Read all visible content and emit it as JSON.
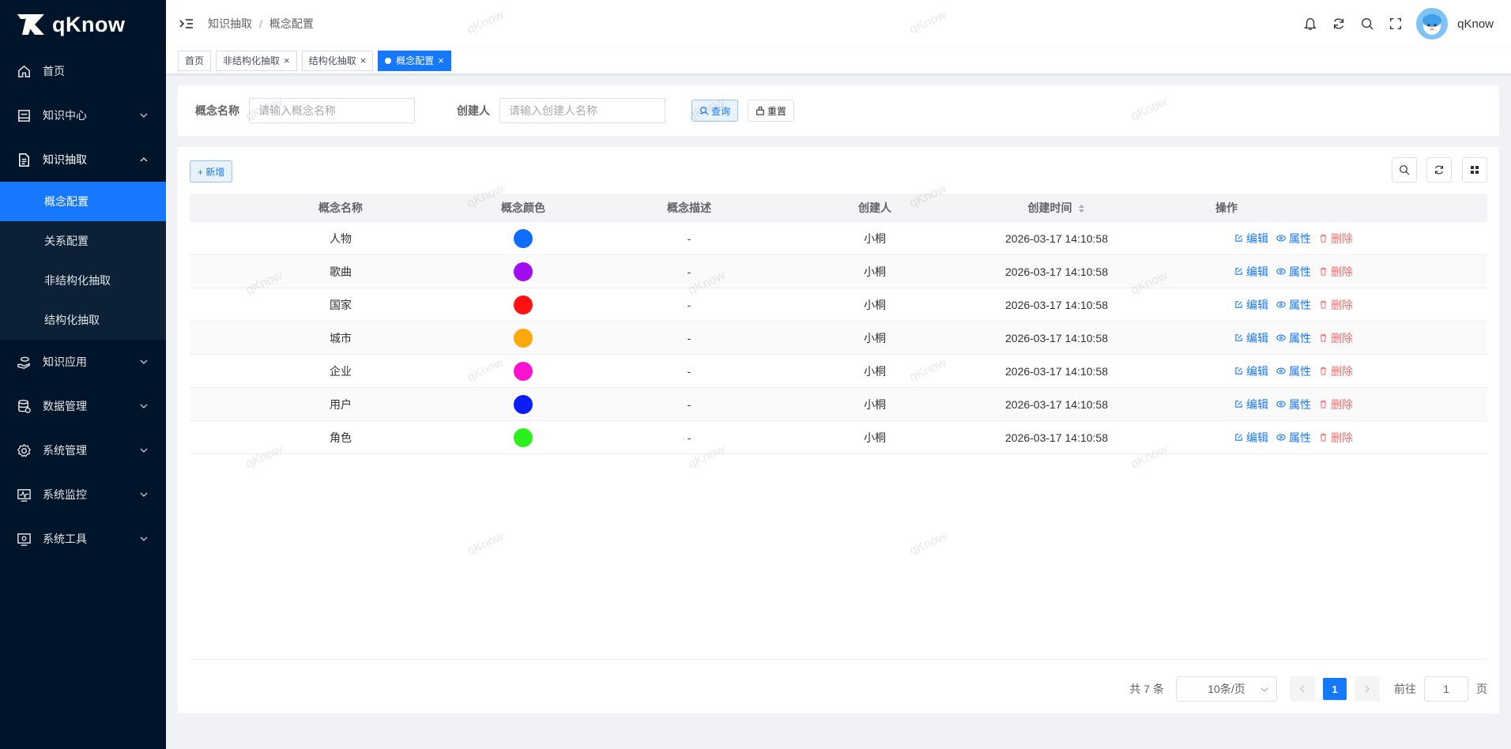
{
  "app": {
    "name": "qKnow"
  },
  "sidebar": {
    "items": [
      {
        "label": "首页"
      },
      {
        "label": "知识中心"
      },
      {
        "label": "知识抽取"
      },
      {
        "label": "知识应用"
      },
      {
        "label": "数据管理"
      },
      {
        "label": "系统管理"
      },
      {
        "label": "系统监控"
      },
      {
        "label": "系统工具"
      }
    ],
    "submenu": [
      {
        "label": "概念配置"
      },
      {
        "label": "关系配置"
      },
      {
        "label": "非结构化抽取"
      },
      {
        "label": "结构化抽取"
      }
    ]
  },
  "header": {
    "breadcrumb": [
      "知识抽取",
      "/",
      "概念配置"
    ],
    "username": "qKnow"
  },
  "tags": [
    "首页",
    "非结构化抽取",
    "结构化抽取",
    "概念配置"
  ],
  "search": {
    "name_label": "概念名称",
    "name_placeholder": "请输入概念名称",
    "creator_label": "创建人",
    "creator_placeholder": "请输入创建人名称",
    "query_label": "查询",
    "reset_label": "重置"
  },
  "toolbar": {
    "add_label": "+ 新增"
  },
  "table": {
    "headers": [
      "概念名称",
      "概念颜色",
      "概念描述",
      "创建人",
      "创建时间",
      "操作"
    ],
    "rows": [
      {
        "name": "人物",
        "color": "#0f6dff",
        "desc": "-",
        "creator": "小桐",
        "time": "2026-03-17 14:10:58"
      },
      {
        "name": "歌曲",
        "color": "#a10df0",
        "desc": "-",
        "creator": "小桐",
        "time": "2026-03-17 14:10:58"
      },
      {
        "name": "国家",
        "color": "#fc1212",
        "desc": "-",
        "creator": "小桐",
        "time": "2026-03-17 14:10:58"
      },
      {
        "name": "城市",
        "color": "#fda80c",
        "desc": "-",
        "creator": "小桐",
        "time": "2026-03-17 14:10:58"
      },
      {
        "name": "企业",
        "color": "#fb14d0",
        "desc": "-",
        "creator": "小桐",
        "time": "2026-03-17 14:10:58"
      },
      {
        "name": "用户",
        "color": "#0a1ef5",
        "desc": "-",
        "creator": "小桐",
        "time": "2026-03-17 14:10:58"
      },
      {
        "name": "角色",
        "color": "#2cf01c",
        "desc": "-",
        "creator": "小桐",
        "time": "2026-03-17 14:10:58"
      }
    ],
    "ops": {
      "edit": "编辑",
      "attr": "属性",
      "delete": "删除"
    }
  },
  "pagination": {
    "total": "共 7 条",
    "page_size": "10条/页",
    "current": "1",
    "goto_label": "前往",
    "goto_value": "1",
    "page_suffix": "页"
  },
  "watermark": "qKnow"
}
